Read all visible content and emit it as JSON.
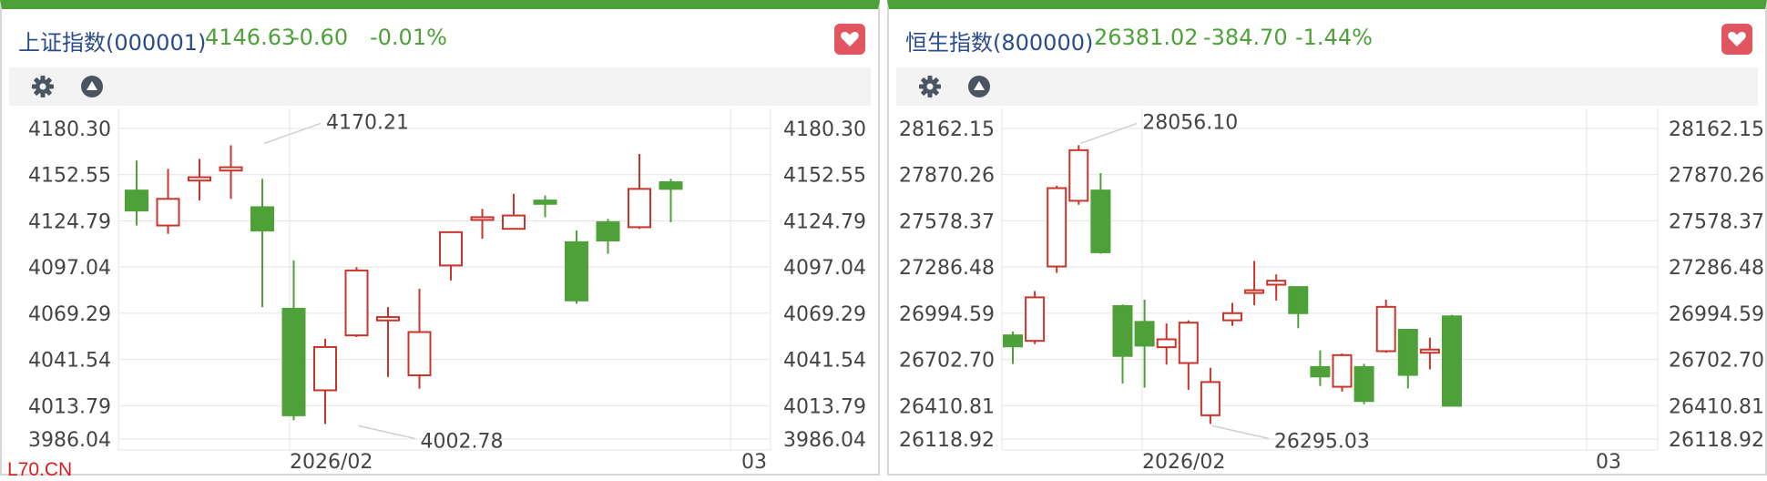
{
  "panels": [
    {
      "name": "上证指数(000001)",
      "price": "4146.63",
      "change": "-0.60",
      "change_pct": "-0.01%",
      "icons": [
        "gear-icon",
        "triangle-up-icon",
        "heart-icon"
      ]
    },
    {
      "name": "恒生指数(800000)",
      "price": "26381.02",
      "change": "-384.70",
      "change_pct": "-1.44%",
      "icons": [
        "gear-icon",
        "triangle-up-icon",
        "heart-icon"
      ]
    }
  ],
  "watermark": "L70.CN",
  "colors": {
    "up": "#c8352b",
    "down": "#4da138",
    "brand_green": "#4da138",
    "title_blue": "#2b4c8c",
    "fav_red": "#e0555f"
  },
  "chart_data": [
    {
      "type": "candlestick",
      "title": "上证指数(000001)",
      "x_labels": [
        "2026/02",
        "03"
      ],
      "y_ticks": [
        "4180.30",
        "4152.55",
        "4124.79",
        "4097.04",
        "4069.29",
        "4041.54",
        "4013.79",
        "3986.04"
      ],
      "ylim": [
        3986.04,
        4180.3
      ],
      "annotations": [
        {
          "text": "4170.21",
          "value": 4170.21,
          "candle": 4
        },
        {
          "text": "4002.78",
          "value": 4002.78,
          "candle": 7
        }
      ],
      "candles": [
        {
          "o": 4143,
          "c": 4131,
          "h": 4161,
          "l": 4122
        },
        {
          "o": 4122,
          "c": 4138,
          "h": 4156,
          "l": 4117
        },
        {
          "o": 4149,
          "c": 4151,
          "h": 4162,
          "l": 4137
        },
        {
          "o": 4155,
          "c": 4157,
          "h": 4170.21,
          "l": 4138
        },
        {
          "o": 4133,
          "c": 4119,
          "h": 4150,
          "l": 4073
        },
        {
          "o": 4072,
          "c": 4008,
          "h": 4101,
          "l": 4005
        },
        {
          "o": 4023,
          "c": 4049,
          "h": 4054,
          "l": 4002.78
        },
        {
          "o": 4056,
          "c": 4095,
          "h": 4097,
          "l": 4055
        },
        {
          "o": 4065,
          "c": 4067,
          "h": 4073,
          "l": 4031
        },
        {
          "o": 4032,
          "c": 4058,
          "h": 4084,
          "l": 4024
        },
        {
          "o": 4098,
          "c": 4118,
          "h": 4118,
          "l": 4089
        },
        {
          "o": 4126,
          "c": 4127,
          "h": 4132,
          "l": 4114
        },
        {
          "o": 4120,
          "c": 4128,
          "h": 4141,
          "l": 4120
        },
        {
          "o": 4137,
          "c": 4135,
          "h": 4140,
          "l": 4127
        },
        {
          "o": 4112,
          "c": 4077,
          "h": 4119,
          "l": 4075
        },
        {
          "o": 4124,
          "c": 4113,
          "h": 4126,
          "l": 4105
        },
        {
          "o": 4121,
          "c": 4144,
          "h": 4165,
          "l": 4120
        },
        {
          "o": 4148,
          "c": 4144,
          "h": 4150,
          "l": 4124
        }
      ]
    },
    {
      "type": "candlestick",
      "title": "恒生指数(800000)",
      "x_labels": [
        "2026/02",
        "03"
      ],
      "y_ticks": [
        "28162.15",
        "27870.26",
        "27578.37",
        "27286.48",
        "26994.59",
        "26702.70",
        "26410.81",
        "26118.92"
      ],
      "ylim": [
        26118.92,
        28162.15
      ],
      "annotations": [
        {
          "text": "28056.10",
          "value": 28056.1,
          "candle": 3
        },
        {
          "text": "26295.03",
          "value": 26295.03,
          "candle": 9
        }
      ],
      "candles": [
        {
          "o": 26855,
          "c": 26785,
          "h": 26880,
          "l": 26675
        },
        {
          "o": 26820,
          "c": 27095,
          "h": 27135,
          "l": 26800
        },
        {
          "o": 27290,
          "c": 27785,
          "h": 27800,
          "l": 27250
        },
        {
          "o": 27705,
          "c": 28025,
          "h": 28056.1,
          "l": 27680
        },
        {
          "o": 27770,
          "c": 27380,
          "h": 27880,
          "l": 27370
        },
        {
          "o": 27040,
          "c": 26725,
          "h": 27050,
          "l": 26550
        },
        {
          "o": 26940,
          "c": 26790,
          "h": 27080,
          "l": 26525
        },
        {
          "o": 26780,
          "c": 26830,
          "h": 26930,
          "l": 26670
        },
        {
          "o": 26680,
          "c": 26935,
          "h": 26950,
          "l": 26510
        },
        {
          "o": 26350,
          "c": 26560,
          "h": 26650,
          "l": 26295.03
        },
        {
          "o": 26950,
          "c": 26995,
          "h": 27060,
          "l": 26915
        },
        {
          "o": 27140,
          "c": 27140,
          "h": 27325,
          "l": 27045
        },
        {
          "o": 27175,
          "c": 27200,
          "h": 27240,
          "l": 27075
        },
        {
          "o": 27160,
          "c": 26995,
          "h": 27165,
          "l": 26900
        },
        {
          "o": 26655,
          "c": 26595,
          "h": 26760,
          "l": 26535
        },
        {
          "o": 26530,
          "c": 26730,
          "h": 26740,
          "l": 26500
        },
        {
          "o": 26655,
          "c": 26440,
          "h": 26675,
          "l": 26420
        },
        {
          "o": 26755,
          "c": 27035,
          "h": 27080,
          "l": 26745
        },
        {
          "o": 26890,
          "c": 26605,
          "h": 26895,
          "l": 26520
        },
        {
          "o": 26745,
          "c": 26765,
          "h": 26840,
          "l": 26640
        },
        {
          "o": 26975,
          "c": 26410,
          "h": 26985,
          "l": 26405
        }
      ]
    }
  ]
}
